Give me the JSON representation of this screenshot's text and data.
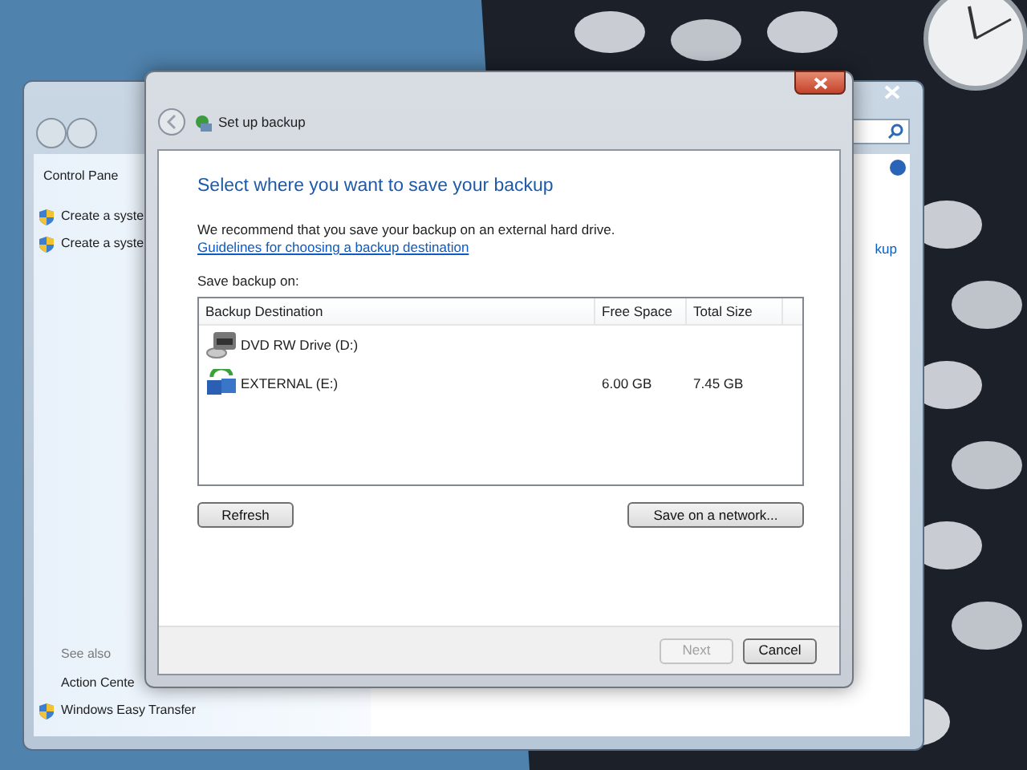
{
  "background_window": {
    "breadcrumb": "Control Pane",
    "tasks": [
      {
        "label": "Create a syste",
        "shield": true
      },
      {
        "label": "Create a syste",
        "shield": true
      }
    ],
    "right_fragment": "kup",
    "see_also": {
      "heading": "See also",
      "links": [
        {
          "label": "Action Cente",
          "shield": false
        },
        {
          "label": "Windows Easy Transfer",
          "shield": true
        }
      ]
    }
  },
  "dialog": {
    "title": "Set up backup",
    "heading": "Select where you want to save your backup",
    "intro": "We recommend that you save your backup on an external hard drive.",
    "link": "Guidelines for choosing a backup destination",
    "list_label": "Save backup on:",
    "columns": [
      "Backup Destination",
      "Free Space",
      "Total Size"
    ],
    "rows": [
      {
        "kind": "dvd",
        "name": "DVD RW Drive (D:)",
        "selected": false
      },
      {
        "kind": "external",
        "name": "EXTERNAL (E:)",
        "free": "6.00 GB",
        "total": "7.45 GB",
        "selected": false
      }
    ],
    "list_buttons": [
      "Refresh",
      "Save on a network..."
    ],
    "footer_buttons": [
      {
        "label": "Next",
        "disabled": true
      },
      {
        "label": "Cancel",
        "disabled": false
      }
    ]
  }
}
